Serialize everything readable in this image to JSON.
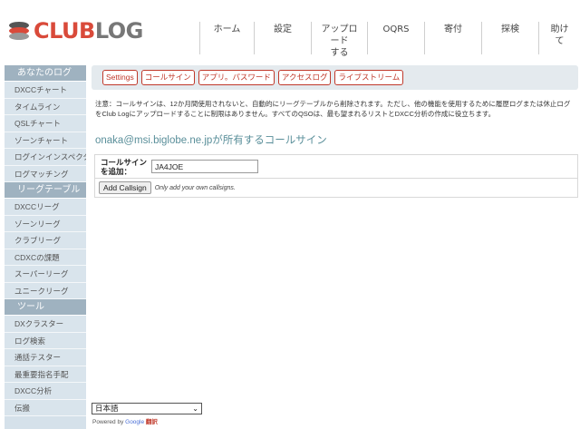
{
  "logo": {
    "part1": "CLUB",
    "part2": "LOG"
  },
  "topnav": [
    "ホーム",
    "設定",
    "アップロード\nする",
    "OQRS",
    "寄付",
    "探検",
    "助けて"
  ],
  "sidebar": {
    "sections": [
      {
        "heading": "あなたのログ",
        "items": [
          "DXCCチャート",
          "タイムライン",
          "QSLチャート",
          "ゾーンチャート",
          "ログインインスペクター",
          "ログマッチング"
        ]
      },
      {
        "heading": "リーグテーブル",
        "items": [
          "DXCCリーグ",
          "ゾーンリーグ",
          "クラブリーグ",
          "CDXCの課題",
          "スーパーリーグ",
          "ユニークリーグ"
        ]
      },
      {
        "heading": "ツール",
        "items": [
          "DXクラスター",
          "ログ検索",
          "通話テスター",
          "最重要指名手配",
          "DXCC分析",
          "伝搬"
        ]
      }
    ]
  },
  "subnav": [
    "Settings",
    "コールサイン",
    "アプリ。パスワード",
    "アクセスログ",
    "ライブストリーム"
  ],
  "notice": "注意：コールサインは、12か月間使用されないと、自動的にリーグテーブルから削除されます。ただし、他の機能を使用するために履歴ログまたは休止ログをClub Logにアップロードすることに制限はありません。すべてのQSOは、最も望まれるリストとDXCC分析の作成に役立ちます。",
  "section_title": "onaka@msi.biglobe.ne.jpが所有するコールサイン",
  "form": {
    "label": "コールサイン\nを追加：",
    "input_value": "JA4JOE",
    "button": "Add Callsign",
    "hint": "Only add your own callsigns."
  },
  "footer": {
    "language": "日本語",
    "powered_prefix": "Powered by",
    "google": "Google",
    "translate": "翻訳"
  },
  "colors": {
    "accent": "#c0392b",
    "sidebar_heading": "#9fb2c0",
    "sidebar_bg": "#d5e1ea",
    "title": "#5a8f9a"
  }
}
